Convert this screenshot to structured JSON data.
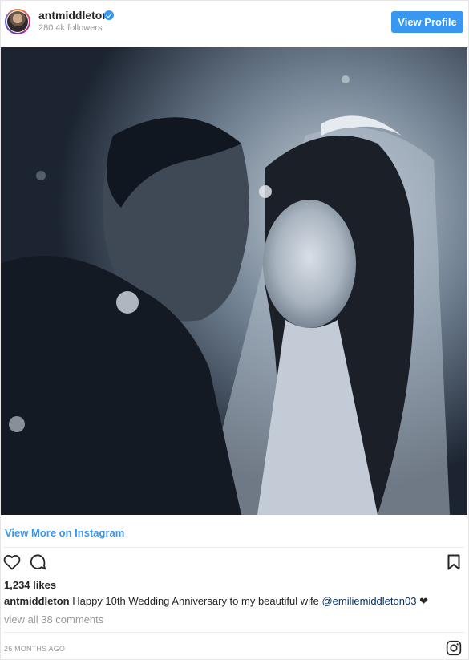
{
  "header": {
    "username": "antmiddleton",
    "followers": "280.4k followers",
    "view_profile_label": "View Profile"
  },
  "post": {
    "view_more_label": "View More on Instagram",
    "likes": "1,234 likes",
    "caption_user": "antmiddleton",
    "caption_text": "Happy 10th Wedding Anniversary to my beautiful wife ",
    "caption_mention": "@emiliemiddleton03",
    "caption_emoji": "❤",
    "comments_link": "view all 38 comments",
    "timestamp": "26 MONTHS AGO"
  },
  "icons": {
    "verified": "verified-badge-icon",
    "like": "heart-icon",
    "comment": "comment-icon",
    "save": "bookmark-icon",
    "instagram": "instagram-logo-icon"
  },
  "colors": {
    "accent": "#3897f0",
    "mention": "#003569",
    "muted": "#999999",
    "text": "#262626"
  }
}
